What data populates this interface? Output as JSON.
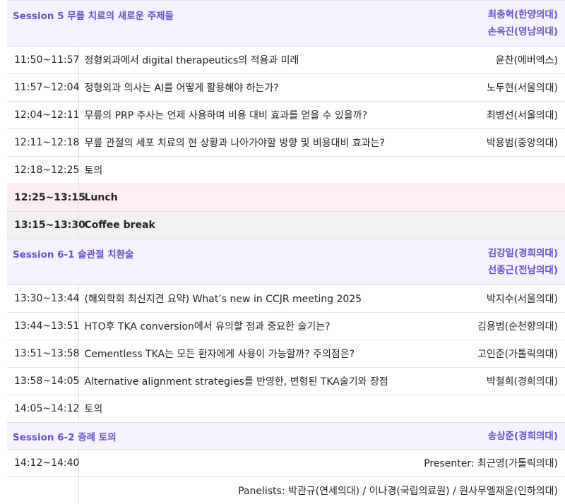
{
  "session5": {
    "title": "Session 5 무릎 치료의 새로운 주제들",
    "chairs": [
      "최충혁(한양의대)",
      "손옥진(영남의대)"
    ],
    "rows": [
      {
        "time": "11:50~11:57",
        "topic": "정형외과에서 digital therapeutics의 적용과 미래",
        "speaker": "윤찬(에버엑스)"
      },
      {
        "time": "11:57~12:04",
        "topic": "정형외과 의사는 AI를 어떻게 활용해야 하는가?",
        "speaker": "노두현(서울의대)"
      },
      {
        "time": "12:04~12:11",
        "topic": "무릎의 PRP 주사는 언제 사용하며 비용 대비 효과를 얻을 수 있을까?",
        "speaker": "최병선(서울의대)"
      },
      {
        "time": "12:11~12:18",
        "topic": "무릎 관절의 세포 치료의 현 상황과 나아가야할 방향 및 비용대비 효과는?",
        "speaker": "박용범(중앙의대)"
      },
      {
        "time": "12:18~12:25",
        "topic": "토의",
        "speaker": ""
      }
    ]
  },
  "lunch": {
    "time": "12:25~13:15",
    "label": "Lunch"
  },
  "coffee": {
    "time": "13:15~13:30",
    "label": "Coffee break"
  },
  "session61": {
    "title": "Session 6-1 슬관절 치환술",
    "chairs": [
      "김강일(경희의대)",
      "선종근(전남의대)"
    ],
    "rows": [
      {
        "time": "13:30~13:44",
        "topic": "(해외학회 최신지견 요약) What’s new in CCJR meeting 2025",
        "speaker": "박지수(서울의대)"
      },
      {
        "time": "13:44~13:51",
        "topic": "HTO후 TKA conversion에서 유의할 점과 중요한 술기는?",
        "speaker": "김용범(순천향의대)"
      },
      {
        "time": "13:51~13:58",
        "topic": "Cementless TKA는 모든 환자에게 사용이 가능할까? 주의점은?",
        "speaker": "고인준(가톨릭의대)"
      },
      {
        "time": "13:58~14:05",
        "topic": "Alternative alignment strategies를 반영한, 변형된 TKA술기와 장점",
        "speaker": "박철희(경희의대)"
      },
      {
        "time": "14:05~14:12",
        "topic": "토의",
        "speaker": ""
      }
    ]
  },
  "session62": {
    "title": "Session 6-2 증례 토의",
    "chair": "송상준(경희의대)",
    "time": "14:12~14:40",
    "presenter": "Presenter: 최근영(가톨릭의대)",
    "panelists": "Panelists: 박관규(연세의대) / 이나경(국립의료원) / 원사무엘재윤(인하의대)"
  },
  "colors": {
    "session_bg": "#f3f2fd",
    "session_text": "#6d4fc4",
    "lunch_bg": "#fdeef4",
    "coffee_bg": "#f1f1f1",
    "border": "#e1dfe8"
  }
}
